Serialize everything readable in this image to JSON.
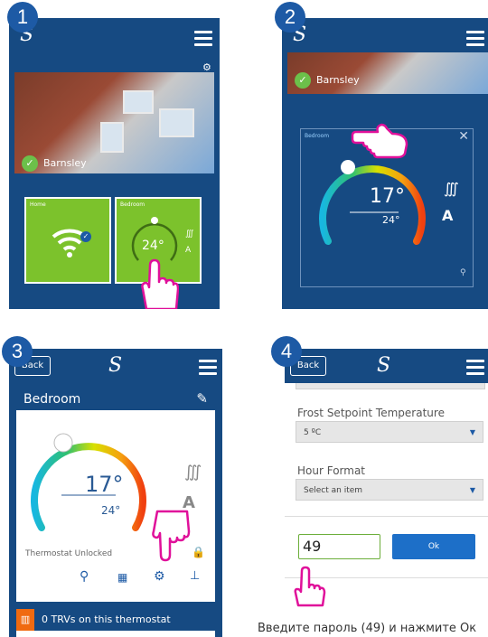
{
  "steps": [
    "1",
    "2",
    "3",
    "4"
  ],
  "panel1": {
    "location": "Barnsley",
    "tile_home_label": "Home",
    "tile_bedroom_label": "Bedroom",
    "tile_temp": "24°"
  },
  "panel2": {
    "location": "Barnsley",
    "room": "Bedroom",
    "temp_current": "17°",
    "temp_set": "24°"
  },
  "panel3": {
    "back": "Back",
    "room": "Bedroom",
    "temp_current": "17°",
    "temp_set": "24°",
    "status": "Thermostat Unlocked",
    "trv_text": "0 TRVs on this thermostat"
  },
  "panel4": {
    "back": "Back",
    "frost_label": "Frost Setpoint Temperature",
    "frost_value": "5 ºC",
    "hour_label": "Hour Format",
    "hour_value": "Select an item",
    "password_value": "49",
    "ok_label": "Ok"
  },
  "caption": "Введите пароль (49) и нажмите Ок"
}
